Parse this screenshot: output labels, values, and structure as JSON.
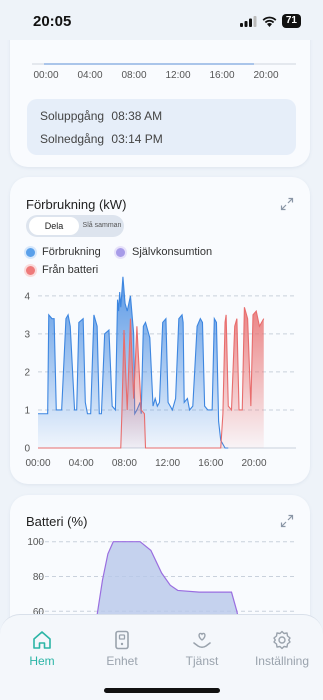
{
  "status_bar": {
    "time": "20:05",
    "battery": "71"
  },
  "top_card": {
    "x_ticks": [
      "00:00",
      "04:00",
      "08:00",
      "12:00",
      "16:00",
      "20:00"
    ],
    "sunrise": {
      "label": "Soluppgång",
      "value": "08:38 AM"
    },
    "sunset": {
      "label": "Solnedgång",
      "value": "03:14 PM"
    }
  },
  "consumption_card": {
    "title": "Förbrukning (kW)",
    "toggle": {
      "active": "Dela",
      "inactive": "Slå samman"
    },
    "legend": [
      {
        "label": "Förbrukning",
        "color": "#5aa0ea"
      },
      {
        "label": "Självkonsumtion",
        "color": "#a79be8"
      },
      {
        "label": "Från batteri",
        "color": "#ee7a7a"
      }
    ]
  },
  "chart_data": [
    {
      "type": "area",
      "title": "Förbrukning (kW)",
      "x_ticks": [
        "00:00",
        "04:00",
        "08:00",
        "12:00",
        "16:00",
        "20:00"
      ],
      "y_ticks": [
        0,
        1,
        2,
        3,
        4
      ],
      "ylim": [
        0,
        4.6
      ],
      "xlim": [
        0,
        24
      ],
      "grid": true,
      "series": [
        {
          "name": "Förbrukning",
          "color": "#3d86e0",
          "x": [
            0,
            0.9,
            1.0,
            1.3,
            1.5,
            1.7,
            2.2,
            2.6,
            2.8,
            3.0,
            3.4,
            3.6,
            3.8,
            4.2,
            4.4,
            4.6,
            4.9,
            5.2,
            5.5,
            5.7,
            5.9,
            6.2,
            6.6,
            6.9,
            7.2,
            7.4,
            7.5,
            7.6,
            7.7,
            7.9,
            8.1,
            8.3,
            8.6,
            8.9,
            9.0,
            9.2,
            9.5,
            9.6,
            9.8,
            10.0,
            10.4,
            10.7,
            10.9,
            11.1,
            11.3,
            11.6,
            11.9,
            12.1,
            12.3,
            12.5,
            12.8,
            13.1,
            13.4,
            13.5,
            13.6,
            13.9,
            14.1,
            14.4,
            14.8,
            15.1,
            15.3,
            15.5,
            15.8,
            16.2,
            16.4,
            16.6,
            16.8,
            17.0,
            17.4,
            17.6,
            17.7
          ],
          "values": [
            0.9,
            0.9,
            3.5,
            3.4,
            3.4,
            1.0,
            1.0,
            3.4,
            3.5,
            3.2,
            1.0,
            1.0,
            3.3,
            3.4,
            1.2,
            0.9,
            0.9,
            3.5,
            3.2,
            0.9,
            0.9,
            3.0,
            3.1,
            1.1,
            1.0,
            3.9,
            3.6,
            4.1,
            3.7,
            4.5,
            3.8,
            3.6,
            4.0,
            3.0,
            0.9,
            1.0,
            1.2,
            0.9,
            3.2,
            3.3,
            2.9,
            1.1,
            1.3,
            1.1,
            1.2,
            3.3,
            3.4,
            1.2,
            1.1,
            1.0,
            1.3,
            3.4,
            3.5,
            3.3,
            1.2,
            1.3,
            1.0,
            1.1,
            3.2,
            3.4,
            3.3,
            1.1,
            1.0,
            1.0,
            3.4,
            3.3,
            0.7,
            0.2,
            0,
            0,
            0
          ]
        },
        {
          "name": "Från batteri",
          "color": "#e86d6d",
          "x": [
            0,
            7.7,
            7.8,
            8.0,
            8.3,
            8.6,
            8.9,
            9.2,
            9.6,
            9.9,
            10.0,
            17.0,
            17.2,
            17.4,
            17.5,
            17.7,
            18.0,
            18.3,
            18.5,
            18.7,
            19.0,
            19.2,
            19.5,
            19.8,
            20.0,
            20.3,
            20.6,
            21.0
          ],
          "values": [
            0,
            0,
            0.9,
            3.1,
            1.0,
            3.4,
            1.3,
            3.2,
            1.0,
            0.9,
            0,
            0,
            0.9,
            3.3,
            3.5,
            1.1,
            1.0,
            3.2,
            3.4,
            1.0,
            1.0,
            3.7,
            3.4,
            1.1,
            3.5,
            3.6,
            3.2,
            3.4
          ]
        }
      ]
    },
    {
      "type": "area",
      "title": "Batteri (%)",
      "y_ticks": [
        100,
        80,
        60
      ],
      "ylim": [
        55,
        105
      ],
      "xlim": [
        0,
        24
      ],
      "grid": true,
      "series": [
        {
          "name": "Batteri",
          "color": "#9a6ee0",
          "x": [
            5.0,
            5.5,
            6.0,
            6.5,
            7.0,
            8.5,
            9.5,
            10.5,
            11.5,
            12.3,
            13.0,
            15.0,
            17.0,
            18.0,
            18.5,
            19.0
          ],
          "values": [
            45,
            58,
            78,
            93,
            100,
            100,
            100,
            95,
            82,
            75,
            72,
            71,
            71,
            71,
            60,
            45
          ]
        }
      ]
    }
  ],
  "battery_card": {
    "title": "Batteri (%)"
  },
  "tabbar": {
    "tabs": [
      {
        "label": "Hem"
      },
      {
        "label": "Enhet"
      },
      {
        "label": "Tjänst"
      },
      {
        "label": "Inställning"
      }
    ]
  }
}
